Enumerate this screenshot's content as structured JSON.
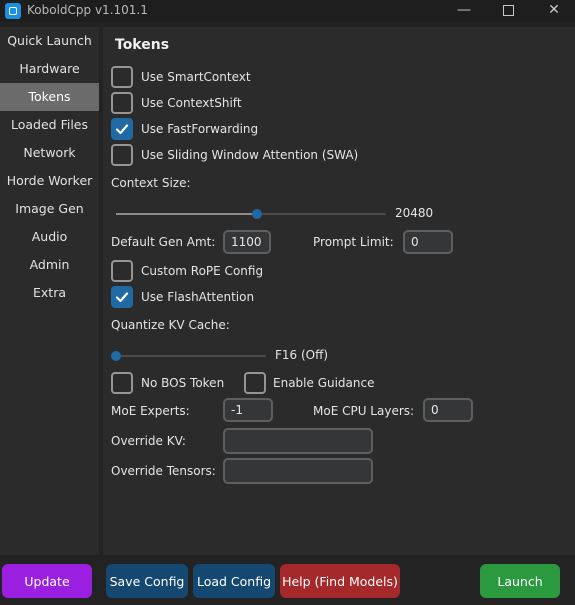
{
  "window": {
    "title": "KoboldCpp v1.101.1",
    "min_glyph": "—",
    "close_glyph": "✕"
  },
  "sidebar": {
    "items": [
      {
        "label": "Quick Launch"
      },
      {
        "label": "Hardware"
      },
      {
        "label": "Tokens",
        "active": true
      },
      {
        "label": "Loaded Files"
      },
      {
        "label": "Network"
      },
      {
        "label": "Horde Worker"
      },
      {
        "label": "Image Gen"
      },
      {
        "label": "Audio"
      },
      {
        "label": "Admin"
      },
      {
        "label": "Extra"
      }
    ]
  },
  "tokens": {
    "title": "Tokens",
    "checkboxes": {
      "smartcontext": {
        "label": "Use SmartContext",
        "checked": false
      },
      "contextshift": {
        "label": "Use ContextShift",
        "checked": false
      },
      "fastforwarding": {
        "label": "Use FastForwarding",
        "checked": true
      },
      "swa": {
        "label": "Use Sliding Window Attention (SWA)",
        "checked": false
      },
      "customrope": {
        "label": "Custom RoPE Config",
        "checked": false
      },
      "flashattention": {
        "label": "Use FlashAttention",
        "checked": true
      },
      "nobos": {
        "label": "No BOS Token",
        "checked": false
      },
      "guidance": {
        "label": "Enable Guidance",
        "checked": false
      }
    },
    "context_size": {
      "label": "Context Size:",
      "value_text": "20480",
      "slider_fraction": 0.5
    },
    "default_gen_amt": {
      "label": "Default Gen Amt:",
      "value": "1100"
    },
    "prompt_limit": {
      "label": "Prompt Limit:",
      "value": "0"
    },
    "quantize_kv": {
      "label": "Quantize KV Cache:",
      "value_text": "F16 (Off)",
      "slider_fraction": 0.0
    },
    "moe_experts": {
      "label": "MoE Experts:",
      "value": "-1"
    },
    "moe_cpu_layers": {
      "label": "MoE CPU Layers:",
      "value": "0"
    },
    "override_kv": {
      "label": "Override KV:",
      "value": ""
    },
    "override_tensors": {
      "label": "Override Tensors:",
      "value": ""
    }
  },
  "buttons": {
    "update": "Update",
    "save_config": "Save Config",
    "load_config": "Load Config",
    "help": "Help (Find Models)",
    "launch": "Launch"
  },
  "colors": {
    "accent": "#1f6aa5",
    "update": "#9b1fe0",
    "save_load": "#144870",
    "help": "#a5282a",
    "launch": "#2b9a3f"
  }
}
